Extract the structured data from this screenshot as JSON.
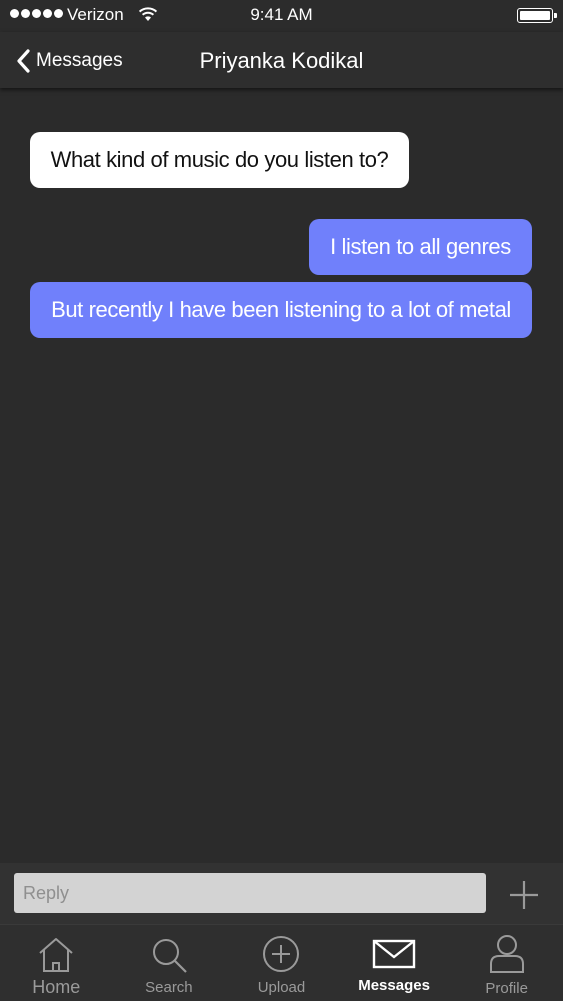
{
  "status_bar": {
    "carrier": "Verizon",
    "time": "9:41 AM"
  },
  "nav": {
    "back_label": "Messages",
    "title": "Priyanka Kodikal"
  },
  "messages": [
    {
      "sender": "contact",
      "text": "What kind of music do you listen to?"
    },
    {
      "sender": "me",
      "text": "I listen to all genres"
    },
    {
      "sender": "me",
      "text": "But recently I have been listening to a lot of metal"
    }
  ],
  "reply": {
    "placeholder": "Reply",
    "value": ""
  },
  "tabs": [
    {
      "label": "Home",
      "icon": "home-icon",
      "active": false
    },
    {
      "label": "Search",
      "icon": "search-icon",
      "active": false
    },
    {
      "label": "Upload",
      "icon": "upload-icon",
      "active": false
    },
    {
      "label": "Messages",
      "icon": "mail-icon",
      "active": true
    },
    {
      "label": "Profile",
      "icon": "profile-icon",
      "active": false
    }
  ],
  "colors": {
    "background": "#2b2b2b",
    "outgoing_bubble": "#7080fb",
    "incoming_bubble": "#ffffff",
    "inactive_tab": "#9a9a9a"
  }
}
